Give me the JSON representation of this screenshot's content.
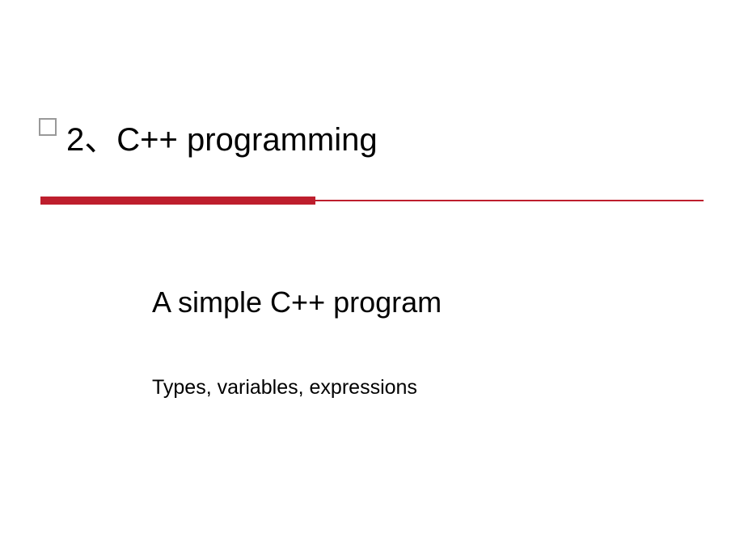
{
  "slide": {
    "title": "2、C++ programming",
    "subtitle": "A simple C++ program",
    "description": "Types, variables, expressions"
  }
}
